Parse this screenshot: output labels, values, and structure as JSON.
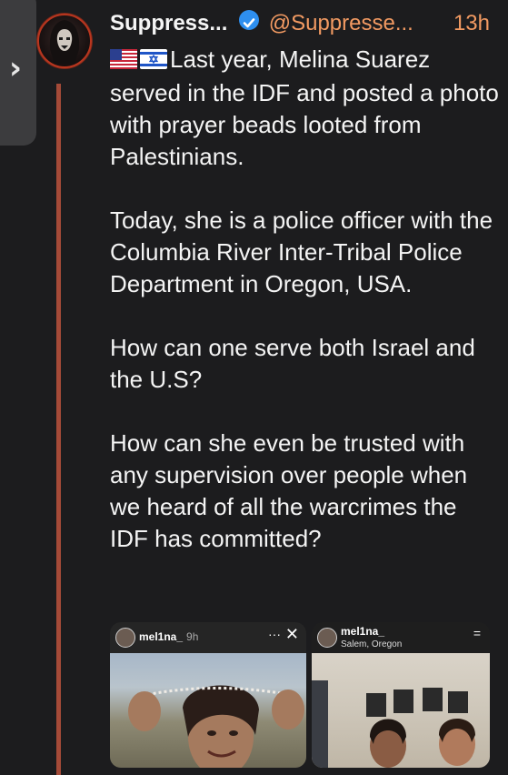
{
  "author": {
    "display_name": "Suppress...",
    "handle": "@Suppresse...",
    "time": "13h",
    "verified": true
  },
  "post": {
    "flags": [
      "us-flag-icon",
      "israel-flag-icon"
    ],
    "paragraphs": [
      "Last year, Melina Suarez served in the IDF and posted a photo with prayer beads looted from Palestinians.",
      "Today, she is a police officer with the Columbia River Inter-Tribal Police Department in Oregon, USA.",
      "How can one serve both Israel and the U.S?",
      "How can she even be trusted with any supervision over people when we heard of all the warcrimes the IDF has committed?"
    ]
  },
  "media": {
    "left": {
      "username": "mel1na_",
      "time": "9h",
      "more": "···",
      "close": "✕"
    },
    "right": {
      "username": "mel1na_",
      "location": "Salem, Oregon",
      "menu": "="
    }
  },
  "colors": {
    "background": "#1c1c1e",
    "accent": "#f29a62",
    "verified": "#2e8ff0",
    "thread_line": "#a44a38"
  }
}
